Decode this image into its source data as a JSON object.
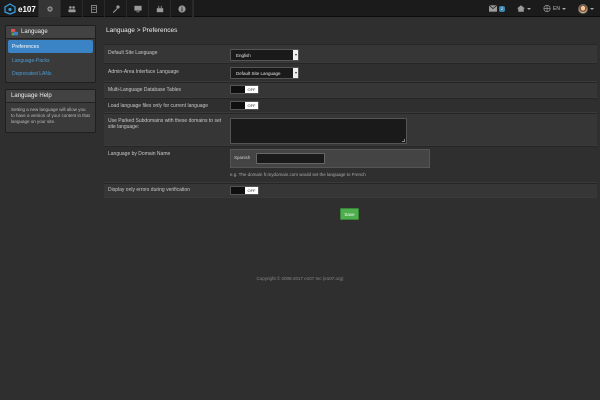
{
  "navbar": {
    "brand": "e107",
    "icons": [
      "home-icon",
      "settings-icon",
      "users-icon",
      "content-icon",
      "tools-icon",
      "monitor-icon",
      "plugin-icon",
      "info-icon"
    ],
    "mail_count": "2",
    "language": "EN"
  },
  "sidebar": {
    "title": "Language",
    "items": [
      {
        "label": "Preferences"
      },
      {
        "label": "Language-Packs"
      },
      {
        "label": "Deprecated LANs"
      }
    ],
    "help_title": "Language Help",
    "help_text": "Setting a new language will allow you to have a version of your content in that language on your site."
  },
  "main": {
    "title": "Language > Preferences",
    "rows": {
      "default_language": {
        "label": "Default Site Language",
        "value": "English"
      },
      "admin_language": {
        "label": "Admin-Area Interface Language",
        "value": "Default Site Language"
      },
      "multi_db": {
        "label": "Multi-Language Database Tables",
        "toggle": "OFF"
      },
      "load_files": {
        "label": "Load language files only for current language",
        "toggle": "OFF"
      },
      "subdomains": {
        "label": "Use Parked Subdomains with these domains to set site language:",
        "value": ""
      },
      "domain": {
        "label": "Language by Domain Name",
        "lang": "Spanish",
        "value": "",
        "hint": "e.g. The domain fr.mydomain.com would set the language to French"
      },
      "errors": {
        "label": "Display only errors during verification",
        "toggle": "OFF"
      }
    },
    "save_label": "Save"
  },
  "footer": "Copyright © 2008-2017 e107 Inc (e107.org)",
  "colors": {
    "accent": "#3a83c4",
    "save": "#4cae4c"
  }
}
